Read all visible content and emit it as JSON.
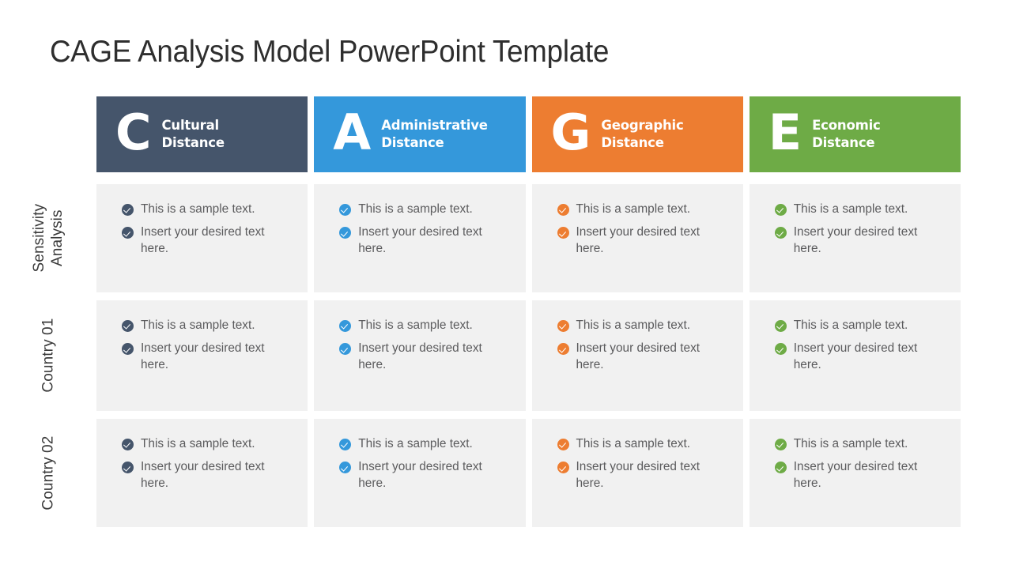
{
  "slide": {
    "title": "CAGE Analysis Model PowerPoint Template"
  },
  "columns": [
    {
      "letter": "C",
      "title_line1": "Cultural",
      "title_line2": "Distance",
      "color": "#45556b",
      "bullet_color": "#45556b"
    },
    {
      "letter": "A",
      "title_line1": "Administrative",
      "title_line2": "Distance",
      "color": "#3498db",
      "bullet_color": "#3498db"
    },
    {
      "letter": "G",
      "title_line1": "Geographic",
      "title_line2": "Distance",
      "color": "#ed7d31",
      "bullet_color": "#ed7d31"
    },
    {
      "letter": "E",
      "title_line1": "Economic",
      "title_line2": "Distance",
      "color": "#6eab46",
      "bullet_color": "#6eab46"
    }
  ],
  "rows": [
    {
      "label_line1": "Sensitivity",
      "label_line2": "Analysis",
      "cells": [
        {
          "bullets": [
            "This is a sample text.",
            "Insert your desired text here."
          ]
        },
        {
          "bullets": [
            "This is a sample text.",
            "Insert your desired text here."
          ]
        },
        {
          "bullets": [
            "This is a sample text.",
            "Insert your desired text here."
          ]
        },
        {
          "bullets": [
            "This is a sample text.",
            "Insert your desired text here."
          ]
        }
      ]
    },
    {
      "label_line1": "Country 01",
      "label_line2": "",
      "cells": [
        {
          "bullets": [
            "This is a sample text.",
            "Insert your desired text here."
          ]
        },
        {
          "bullets": [
            "This is a sample text.",
            "Insert your desired text here."
          ]
        },
        {
          "bullets": [
            "This is a sample text.",
            "Insert your desired text here."
          ]
        },
        {
          "bullets": [
            "This is a sample text.",
            "Insert your desired text here."
          ]
        }
      ]
    },
    {
      "label_line1": "Country 02",
      "label_line2": "",
      "cells": [
        {
          "bullets": [
            "This is a sample text.",
            "Insert your desired text here."
          ]
        },
        {
          "bullets": [
            "This is a sample text.",
            "Insert your desired text here."
          ]
        },
        {
          "bullets": [
            "This is a sample text.",
            "Insert your desired text here."
          ]
        },
        {
          "bullets": [
            "This is a sample text.",
            "Insert your desired text here."
          ]
        }
      ]
    }
  ],
  "theme": {
    "cell_background": "#f1f1f1",
    "slide_background": "#ffffff",
    "title_color": "#2e2e2e",
    "body_text_color": "#5b5b5d",
    "row_label_color": "#3a3a3a",
    "bullet_icon": "check-circle-icon"
  }
}
